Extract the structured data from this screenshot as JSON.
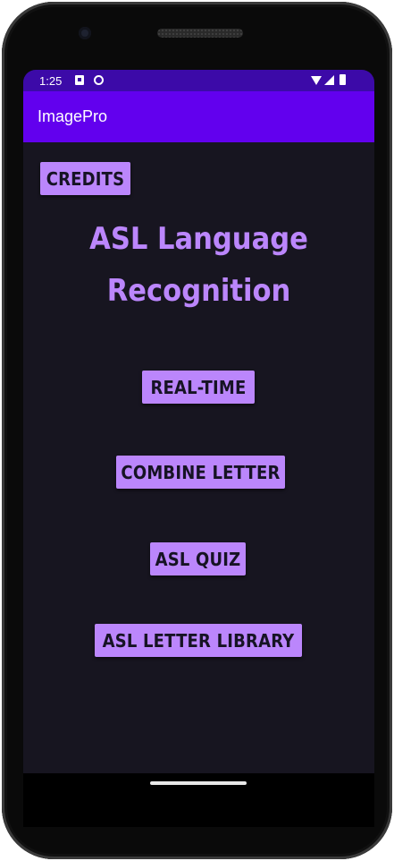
{
  "status_bar": {
    "time": "1:25"
  },
  "app_bar": {
    "title": "ImagePro"
  },
  "main": {
    "credits_label": "CREDITS",
    "headline_line1": "ASL Language",
    "headline_line2": "Recognition",
    "realtime_label": "REAL-TIME",
    "combine_label": "COMBINE LETTER",
    "quiz_label": "ASL QUIZ",
    "library_label": "ASL LETTER LIBRARY"
  },
  "colors": {
    "status_bar": "#3c0aa8",
    "app_bar": "#6200ee",
    "background": "#171520",
    "accent": "#bb86fc"
  }
}
